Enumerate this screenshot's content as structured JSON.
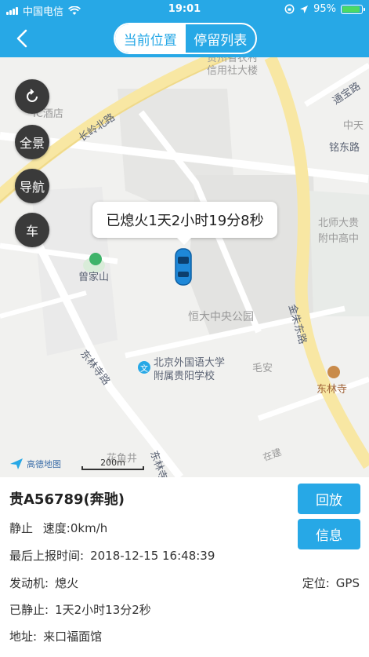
{
  "status_bar": {
    "carrier": "中国电信",
    "time": "19:01",
    "battery": "95%"
  },
  "nav": {
    "tabs": [
      {
        "label": "当前位置",
        "active": true
      },
      {
        "label": "停留列表",
        "active": false
      }
    ]
  },
  "map": {
    "controls": [
      "全景",
      "导航",
      "车"
    ],
    "bubble": "已熄火1天2小时19分8秒",
    "labels": {
      "changling_road": "长岭北路",
      "tongbao_road": "通宝路",
      "mingdong_road": "铭东路",
      "zhongtian": "中天",
      "jinzhu_road": "金朱东路",
      "dongsi_road": "东林寺路",
      "credit": "贵州省农村\n信用社大楼",
      "hotel": "IC酒店",
      "bnu_school": "北师大贵\n附中高中",
      "zengjiashan": "曾家山",
      "hengda_park": "恒大中央公园",
      "beiwai_school": "北京外国语大学\n附属贵阳学校",
      "maoan": "毛安",
      "donglin_temple": "东林寺",
      "huayujing": "花鱼井",
      "donglin_road2": "东林寺",
      "gaode": "高德地图",
      "scale": "200m"
    },
    "colors": {
      "major_road": "#f8e7a3",
      "road": "#ffffff",
      "water_tag": "#27a8e6"
    }
  },
  "vehicle": {
    "plate": "贵A56789(奔驰)",
    "buttons": {
      "replay": "回放",
      "info": "信息"
    },
    "state_label": "静止",
    "speed_label": "速度:",
    "speed_value": "0km/h",
    "report_label": "最后上报时间:",
    "report_value": "2018-12-15 16:48:39",
    "engine_label": "发动机:",
    "engine_value": "熄火",
    "locate_label": "定位:",
    "locate_value": "GPS",
    "stopped_label": "已静止:",
    "stopped_value": "1天2小时13分2秒",
    "address_label": "地址:",
    "address_value": "来口福面馆"
  }
}
